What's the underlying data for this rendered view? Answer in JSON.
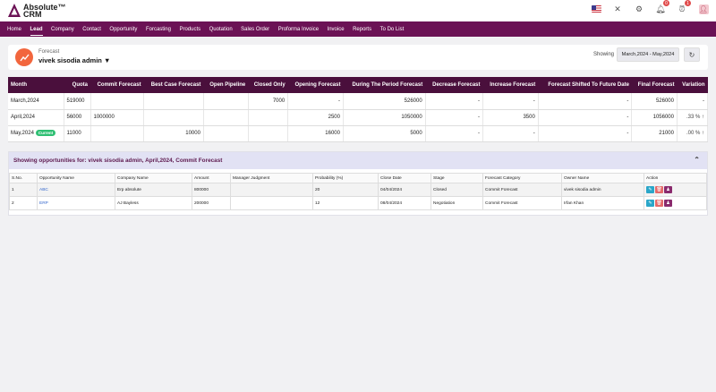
{
  "brand": {
    "line1": "Absolute™",
    "line2": "CRM"
  },
  "header": {
    "notifications_badge": "0",
    "alarm_badge": "1"
  },
  "nav": [
    "Home",
    "Lead",
    "Company",
    "Contact",
    "Opportunity",
    "Forcasting",
    "Products",
    "Quotation",
    "Sales Order",
    "Proforma Invoice",
    "Invoice",
    "Reports",
    "To Do List"
  ],
  "forecast": {
    "label": "Forecast",
    "user": "vivek sisodia admin",
    "showing_label": "Showing",
    "range": "March,2024 - May,2024"
  },
  "forecast_table": {
    "columns": [
      "Month",
      "Quota",
      "Commit Forecast",
      "Best Case Forecast",
      "Open Pipeline",
      "Closed Only",
      "Opening Forecast",
      "During The Period Forecast",
      "Decrease Forecast",
      "Increase Forecast",
      "Forecast Shifted To Future Date",
      "Final Forecast",
      "Variation"
    ],
    "rows": [
      {
        "month": "March,2024",
        "current": "",
        "cells": [
          "519000",
          "",
          "",
          "",
          "7000",
          "-",
          "526000",
          "-",
          "-",
          "-",
          "526000",
          "-"
        ]
      },
      {
        "month": "April,2024",
        "current": "",
        "cells": [
          "56000",
          "1000000",
          "",
          "",
          "",
          "2500",
          "1050000",
          "-",
          "3500",
          "-",
          "1056000",
          ".33 % ↑"
        ]
      },
      {
        "month": "May,2024",
        "current": "Current",
        "cells": [
          "11000",
          "",
          "10000",
          "",
          "",
          "16000",
          "5000",
          "-",
          "-",
          "-",
          "21000",
          ".00 % ↑"
        ]
      }
    ]
  },
  "opportunities": {
    "heading": "Showing opportunities for: vivek sisodia admin, April,2024, Commit Forecast",
    "columns": [
      "S.No.",
      "Opportunity Name",
      "Company Name",
      "Amount",
      "Manager Judgment",
      "Probability (%)",
      "Close Date",
      "Stage",
      "Forecast Category",
      "Owner Name",
      "Action"
    ],
    "rows": [
      [
        "1",
        "ABC",
        "Erp absolute",
        "800000",
        "",
        "20",
        "04/04/2024",
        "Closed",
        "Commit Forecast",
        "vivek sisodia admin"
      ],
      [
        "2",
        "ERP",
        "AJ Bayless",
        "200000",
        "",
        "12",
        "08/04/2024",
        "Negotiation",
        "Commit Forecast",
        "Irfan Khan"
      ]
    ]
  }
}
